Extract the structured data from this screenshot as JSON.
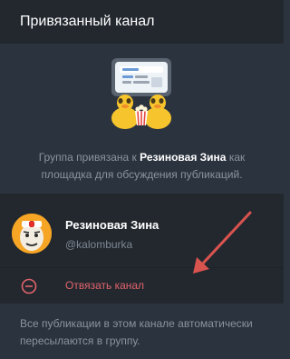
{
  "header": {
    "title": "Привязанный канал"
  },
  "description": {
    "prefix": "Группа привязана к",
    "channel": "Резиновая Зина",
    "suffix": "как площадка для обсуждения публикаций."
  },
  "channel": {
    "name": "Резиновая Зина",
    "handle": "@kalomburka"
  },
  "unlink": {
    "label": "Отвязать канал"
  },
  "footer": {
    "text": "Все публикации в этом канале автоматически пересылаются в группу."
  },
  "colors": {
    "background": "#2b333e",
    "card": "#23282f",
    "danger": "#e0636b",
    "arrow": "#d9534f"
  },
  "icons": {
    "illustration": "duck-screen-icon",
    "unlink": "minus-circle-icon",
    "avatar": "channel-avatar"
  }
}
